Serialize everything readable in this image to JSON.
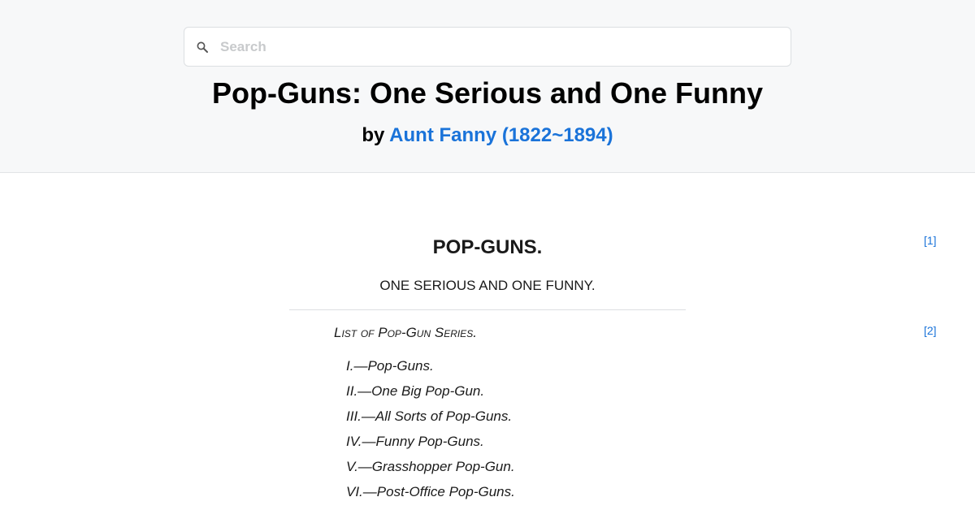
{
  "search": {
    "placeholder": "Search"
  },
  "book": {
    "title": "Pop-Guns: One Serious and One Funny",
    "by_prefix": "by",
    "author": "Aunt Fanny (1822~1894)"
  },
  "content": {
    "page_markers": [
      "[1]",
      "[2]"
    ],
    "heading": "POP-GUNS.",
    "subheading": "ONE SERIOUS AND ONE FUNNY.",
    "list_heading": "List of Pop-Gun Series.",
    "series": [
      "I.—Pop-Guns.",
      "II.—One Big Pop-Gun.",
      "III.—All Sorts of Pop-Guns.",
      "IV.—Funny Pop-Guns.",
      "V.—Grasshopper Pop-Gun.",
      "VI.—Post-Office Pop-Guns."
    ]
  },
  "colors": {
    "link": "#1a73d9",
    "header_bg": "#f7f8f9"
  },
  "icons": {
    "search": "search-icon"
  }
}
